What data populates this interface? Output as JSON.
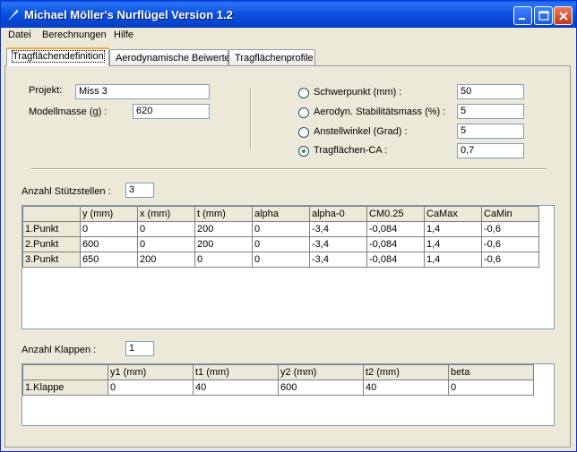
{
  "window": {
    "title": "Michael Möller's Nurflügel Version 1.2"
  },
  "menu": [
    "Datei",
    "Berechnungen",
    "Hilfe"
  ],
  "tabs": [
    "Tragflächendefinition",
    "Aerodynamische Beiwerte",
    "Tragflächenprofile"
  ],
  "active_tab": 0,
  "form": {
    "projekt_label": "Projekt:",
    "projekt_value": "Miss 3",
    "modellmasse_label": "Modellmasse (g) :",
    "modellmasse_value": "620"
  },
  "options": [
    {
      "label": "Schwerpunkt (mm) :",
      "value": "50",
      "checked": false
    },
    {
      "label": "Aerodyn. Stabilitätsmass (%) :",
      "value": "5",
      "checked": false
    },
    {
      "label": "Anstellwinkel (Grad) :",
      "value": "5",
      "checked": false
    },
    {
      "label": "Tragflächen-CA :",
      "value": "0,7",
      "checked": true
    }
  ],
  "stuetz": {
    "label": "Anzahl Stützstellen :",
    "value": "3",
    "columns": [
      "",
      "y (mm)",
      "x (mm)",
      "t (mm)",
      "alpha",
      "alpha-0",
      "CM0.25",
      "CaMax",
      "CaMin"
    ],
    "rows": [
      [
        "1.Punkt",
        "0",
        "0",
        "200",
        "0",
        "-3,4",
        "-0,084",
        "1,4",
        "-0,6"
      ],
      [
        "2.Punkt",
        "600",
        "0",
        "200",
        "0",
        "-3,4",
        "-0,084",
        "1,4",
        "-0,6"
      ],
      [
        "3.Punkt",
        "650",
        "200",
        "0",
        "0",
        "-3,4",
        "-0,084",
        "1,4",
        "-0,6"
      ]
    ]
  },
  "klappen": {
    "label": "Anzahl Klappen :",
    "value": "1",
    "columns": [
      "",
      "y1 (mm)",
      "t1 (mm)",
      "y2 (mm)",
      "t2 (mm)",
      "beta"
    ],
    "rows": [
      [
        "1.Klappe",
        "0",
        "40",
        "600",
        "40",
        "0"
      ]
    ]
  },
  "colors": {
    "title_bar": "#0a52e0",
    "tab_highlight": "#f1a636",
    "radio_dot": "#21a121",
    "window_bg": "#ece9d8"
  }
}
